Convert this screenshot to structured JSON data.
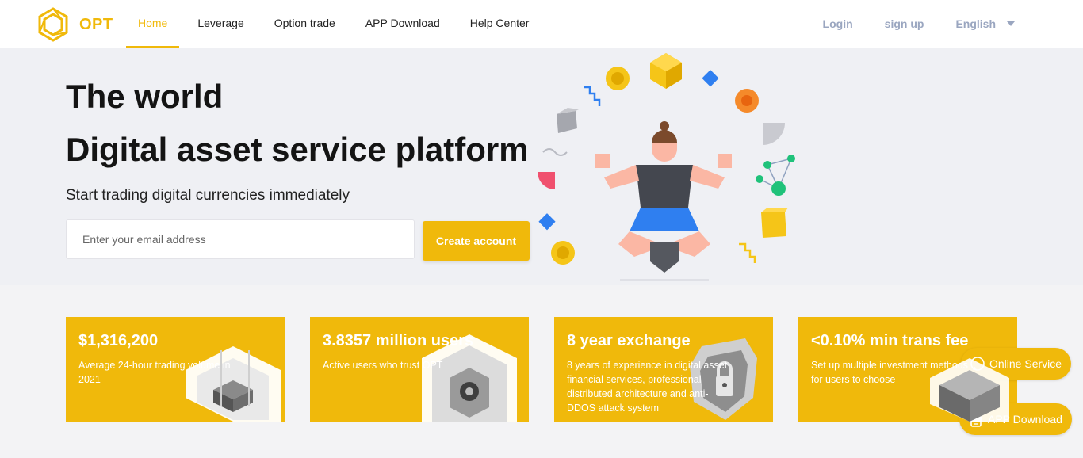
{
  "header": {
    "logo_text": "OPT",
    "nav": [
      "Home",
      "Leverage",
      "Option trade",
      "APP Download",
      "Help Center"
    ],
    "login": "Login",
    "signup": "sign up",
    "language": "English"
  },
  "hero": {
    "title_line1": "The world",
    "title_line2": "Digital asset service platform",
    "subtitle": "Start trading digital currencies immediately",
    "email_placeholder": "Enter your email address",
    "create_button": "Create account"
  },
  "stats": [
    {
      "value": "$1,316,200",
      "desc": "Average 24-hour trading volume in 2021"
    },
    {
      "value": "3.8357 million users",
      "desc": "Active users who trust OPT"
    },
    {
      "value": "8 year exchange",
      "desc": "8 years of experience in digital asset financial services, professional distributed architecture and anti-DDOS attack system"
    },
    {
      "value": "<0.10% min trans fee",
      "desc": "Set up multiple investment methods for users to choose"
    }
  ],
  "floating": {
    "online_service": "Online Service",
    "app_download": "APP Download"
  },
  "colors": {
    "brand": "#f0b90b",
    "hero_bg": "#eff0f4",
    "link_muted": "#9aa6c0"
  }
}
